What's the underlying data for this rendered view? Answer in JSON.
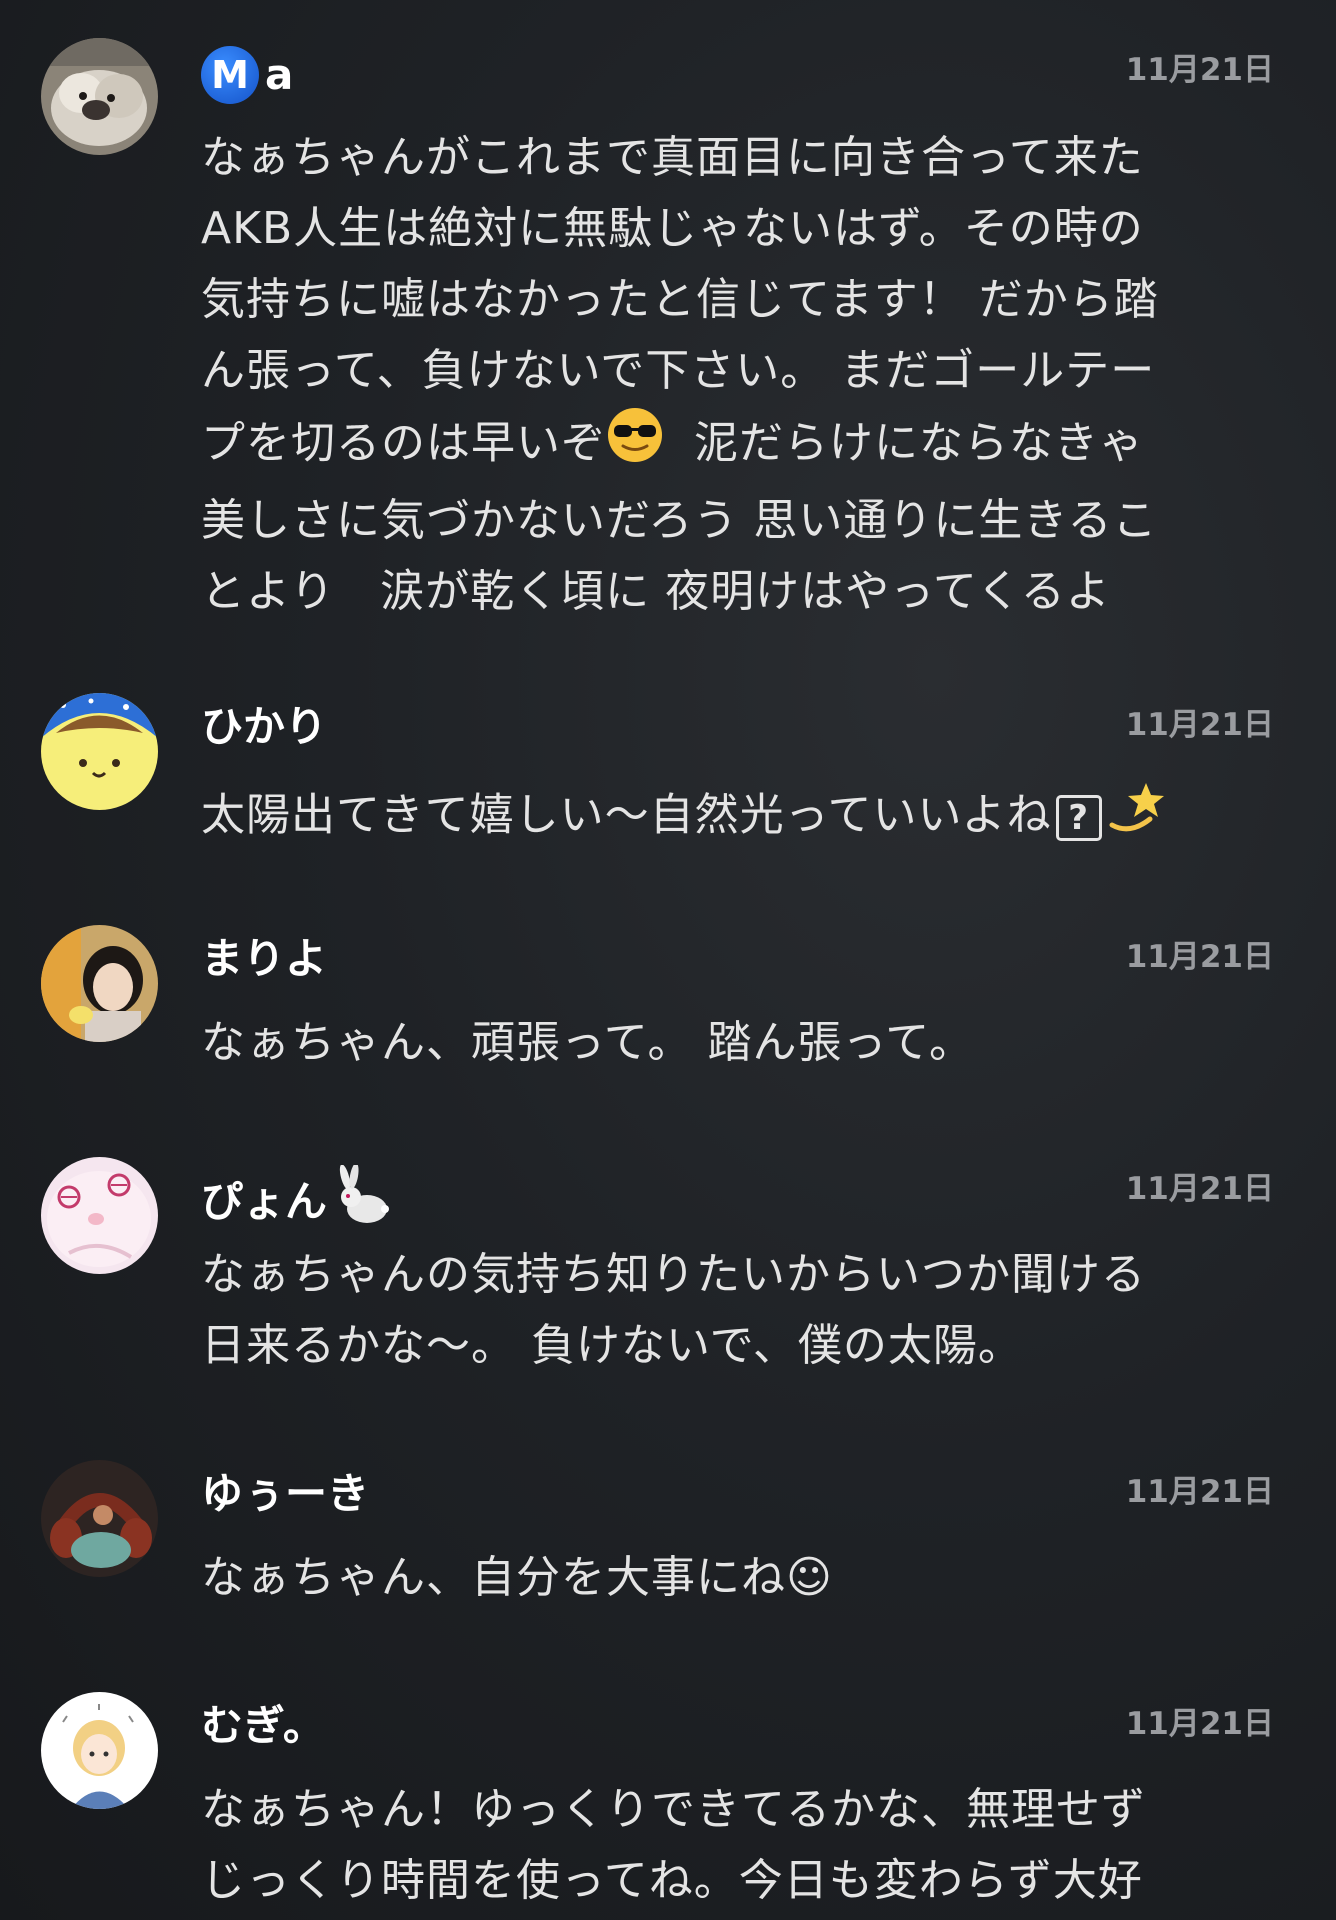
{
  "comments": [
    {
      "username_badge": "M",
      "username": "a",
      "date": "11月21日",
      "text_parts": [
        "なぁちゃんがこれまで真面目に向き合って来た\nAKB人生は絶対に無駄じゃないはず。その時の\n気持ちに嘘はなかったと信じてます！ だから踏\nん張って、負けないで下さい。 まだゴールテー\nプを切るのは早いぞ",
        "  泥だらけにならなきゃ\n美しさに気づかないだろう 思い通りに生きるこ\nとより　涙が乾く頃に 夜明けはやってくるよ"
      ],
      "avatar_icon": "dog-photo-avatar",
      "inline_icon": "sunglasses-emoji-icon"
    },
    {
      "username": "ひかり",
      "date": "11月21日",
      "text": "太陽出てきて嬉しい〜自然光っていいよね",
      "unknown_glyph": "?",
      "avatar_icon": "pompompurin-avatar",
      "inline_icon": "dizzy-star-emoji-icon"
    },
    {
      "username": "まりよ",
      "date": "11月21日",
      "text": "なぁちゃん、頑張って。 踏ん張って。",
      "avatar_icon": "person-photo-avatar"
    },
    {
      "username": "ぴょん",
      "date": "11月21日",
      "text": "なぁちゃんの気持ち知りたいからいつか聞ける\n日来るかな〜。 負けないで、僕の太陽。",
      "avatar_icon": "anime-character-avatar",
      "name_icon": "rabbit-emoji-icon"
    },
    {
      "username": "ゆぅーき",
      "date": "11月21日",
      "text": "なぁちゃん、自分を大事にね☺",
      "avatar_icon": "headphones-photo-avatar"
    },
    {
      "username": "むぎ。",
      "date": "11月21日",
      "text": "なぁちゃん！ゆっくりできてるかな、無理せず\nじっくり時間を使ってね。今日も変わらず大好",
      "avatar_icon": "illustrated-girl-avatar"
    }
  ],
  "colors": {
    "background": "#1f2226",
    "text": "#e4e4e4",
    "username": "#ffffff",
    "timestamp": "#9a9ca0",
    "badge": "#1f6fe8"
  }
}
